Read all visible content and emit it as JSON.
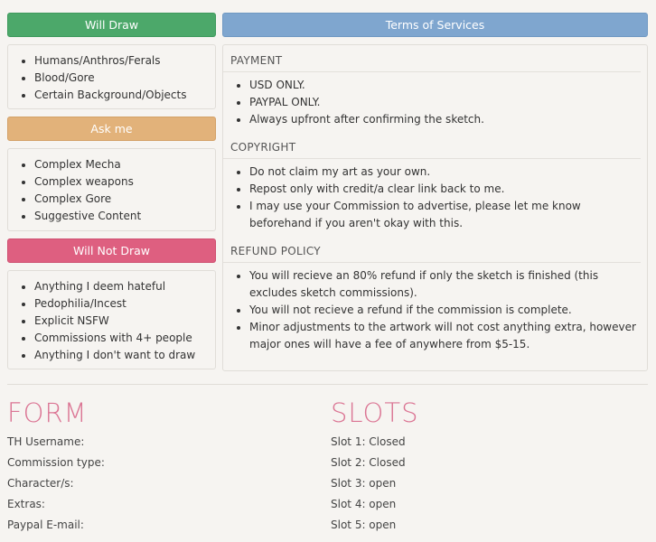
{
  "will_draw": {
    "header": "Will Draw",
    "items": [
      "Humans/Anthros/Ferals",
      "Blood/Gore",
      "Certain Background/Objects"
    ]
  },
  "ask_me": {
    "header": "Ask me",
    "items": [
      "Complex Mecha",
      "Complex weapons",
      "Complex Gore",
      "Suggestive Content"
    ]
  },
  "will_not_draw": {
    "header": "Will Not Draw",
    "items": [
      "Anything I deem hateful",
      "Pedophilia/Incest",
      "Explicit NSFW",
      "Commissions with 4+ people",
      "Anything I don't want to draw"
    ]
  },
  "tos": {
    "header": "Terms of Services",
    "sections": [
      {
        "title": "PAYMENT",
        "items": [
          "USD ONLY.",
          "PAYPAL ONLY.",
          "Always upfront after confirming the sketch."
        ]
      },
      {
        "title": "COPYRIGHT",
        "items": [
          "Do not claim my art as your own.",
          "Repost only with credit/a clear link back to me.",
          "I may use your Commission to advertise, please let me know beforehand if you aren't okay with this."
        ]
      },
      {
        "title": "REFUND POLICY",
        "items": [
          "You will recieve an 80% refund if only the sketch is finished (this excludes sketch commissions).",
          "You will not recieve a refund if the commission is complete.",
          "Minor adjustments to the artwork will not cost anything extra, however major ones will have a fee of anywhere from $5-15."
        ]
      }
    ]
  },
  "form": {
    "title": "FORM",
    "fields": [
      "TH Username:",
      "Commission type:",
      "Character/s:",
      "Extras:",
      "Paypal E-mail:"
    ]
  },
  "slots": {
    "title": "SLOTS",
    "items": [
      "Slot 1: Closed",
      "Slot 2: Closed",
      "Slot 3: open",
      "Slot 4: open",
      "Slot 5: open"
    ]
  },
  "colors": {
    "will_draw": "#4ca86a",
    "ask_me": "#e2b27a",
    "will_not_draw": "#de5f80",
    "tos": "#7fa6cf",
    "heading_pink": "#db7594"
  }
}
